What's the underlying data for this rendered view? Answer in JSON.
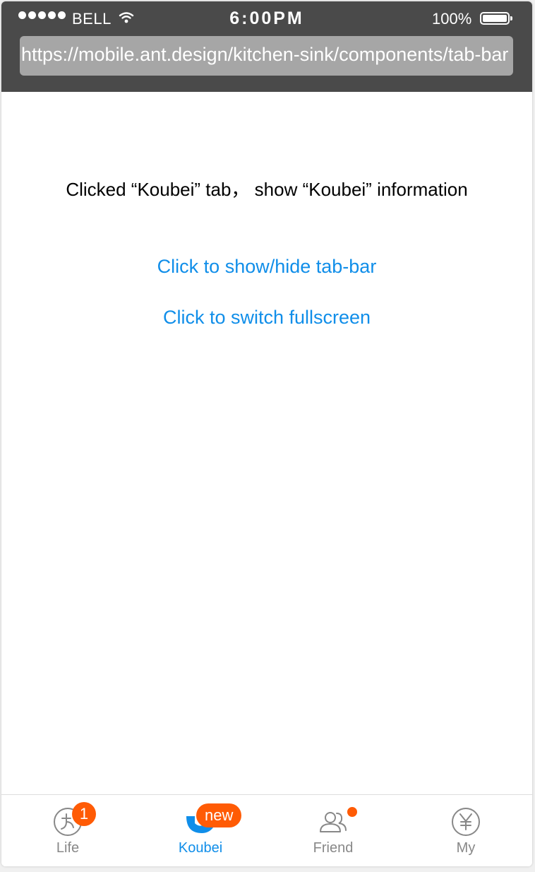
{
  "status_bar": {
    "carrier": "BELL",
    "time": "6:00PM",
    "battery": "100%"
  },
  "browser": {
    "url": "https://mobile.ant.design/kitchen-sink/components/tab-bar"
  },
  "content": {
    "info_text": "Clicked “Koubei” tab，  show “Koubei” information",
    "toggle_tabbar_link": "Click to show/hide tab-bar",
    "fullscreen_link": "Click to switch fullscreen"
  },
  "tab_bar": {
    "active_color": "#108ee9",
    "inactive_color": "#888888",
    "badge_color": "#ff5b05",
    "tabs": [
      {
        "label": "Life",
        "icon": "life-icon",
        "badge": "1"
      },
      {
        "label": "Koubei",
        "icon": "koubei-icon",
        "badge": "new",
        "active": true
      },
      {
        "label": "Friend",
        "icon": "friend-icon",
        "dot": true
      },
      {
        "label": "My",
        "icon": "yen-icon"
      }
    ]
  }
}
